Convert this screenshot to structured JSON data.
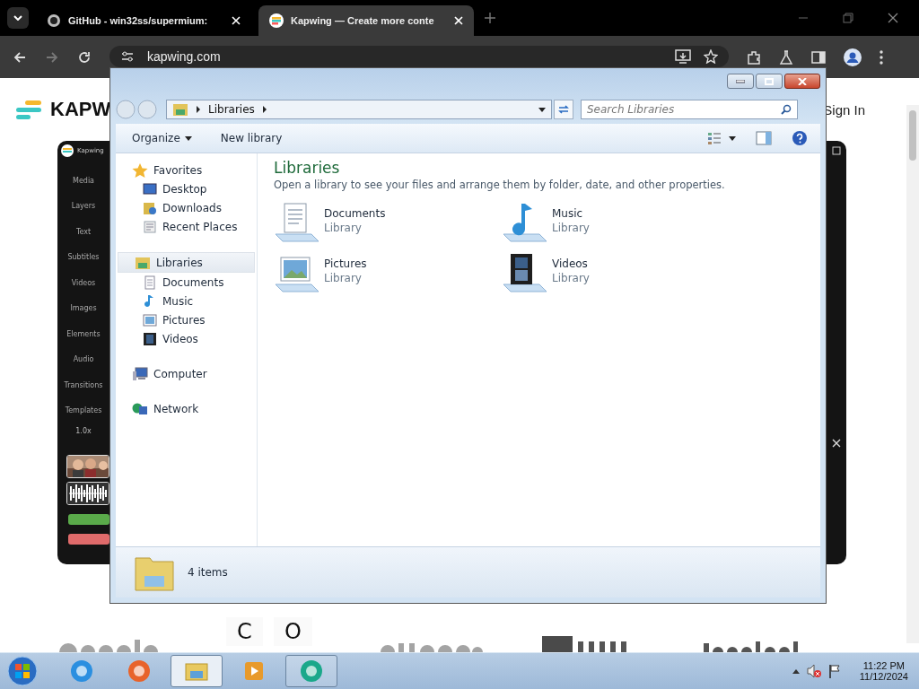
{
  "browser": {
    "tabs": [
      {
        "title": "GitHub - win32ss/supermium:",
        "selected": false
      },
      {
        "title": "Kapwing — Create more conte",
        "selected": true
      }
    ],
    "url": "kapwing.com"
  },
  "page": {
    "logo": "KAPW",
    "sign_in": "Sign In",
    "editor": {
      "title": "Kapwing",
      "speed": "1.0x",
      "tools": [
        "Media",
        "Layers",
        "Text",
        "Subtitles",
        "Videos",
        "Images",
        "Elements",
        "Audio",
        "Transitions",
        "Templates"
      ]
    },
    "letters": [
      "C",
      "O"
    ]
  },
  "explorer": {
    "address": [
      "Libraries"
    ],
    "search_placeholder": "Search Libraries",
    "toolbar": [
      "Organize",
      "New library"
    ],
    "nav": [
      {
        "label": "Favorites",
        "kind": "star",
        "selected": false,
        "children": [
          {
            "label": "Desktop",
            "kind": "desktop",
            "selected": false
          },
          {
            "label": "Downloads",
            "kind": "downloads",
            "selected": false
          },
          {
            "label": "Recent Places",
            "kind": "recent",
            "selected": false
          }
        ]
      },
      {
        "label": "Libraries",
        "kind": "library",
        "selected": true,
        "children": [
          {
            "label": "Documents",
            "kind": "documents",
            "selected": false
          },
          {
            "label": "Music",
            "kind": "music",
            "selected": false
          },
          {
            "label": "Pictures",
            "kind": "pictures",
            "selected": false
          },
          {
            "label": "Videos",
            "kind": "videos",
            "selected": false
          }
        ]
      },
      {
        "label": "Computer",
        "kind": "computer",
        "selected": false
      },
      {
        "label": "Network",
        "kind": "network",
        "selected": false
      }
    ],
    "heading": "Libraries",
    "description": "Open a library to see your files and arrange them by folder, date, and other properties.",
    "libraries": [
      {
        "name": "Documents",
        "type": "Library",
        "kind": "documents"
      },
      {
        "name": "Music",
        "type": "Library",
        "kind": "music"
      },
      {
        "name": "Pictures",
        "type": "Library",
        "kind": "pictures"
      },
      {
        "name": "Videos",
        "type": "Library",
        "kind": "videos"
      }
    ],
    "status": "4 items"
  },
  "taskbar": {
    "apps": [
      {
        "kind": "ie",
        "selected": false,
        "running": false
      },
      {
        "kind": "firefox",
        "selected": false,
        "running": false
      },
      {
        "kind": "folder",
        "selected": true,
        "running": true
      },
      {
        "kind": "player",
        "selected": false,
        "running": false
      },
      {
        "kind": "round",
        "selected": false,
        "running": true
      }
    ],
    "time": "11:22 PM",
    "date": "11/12/2024"
  }
}
